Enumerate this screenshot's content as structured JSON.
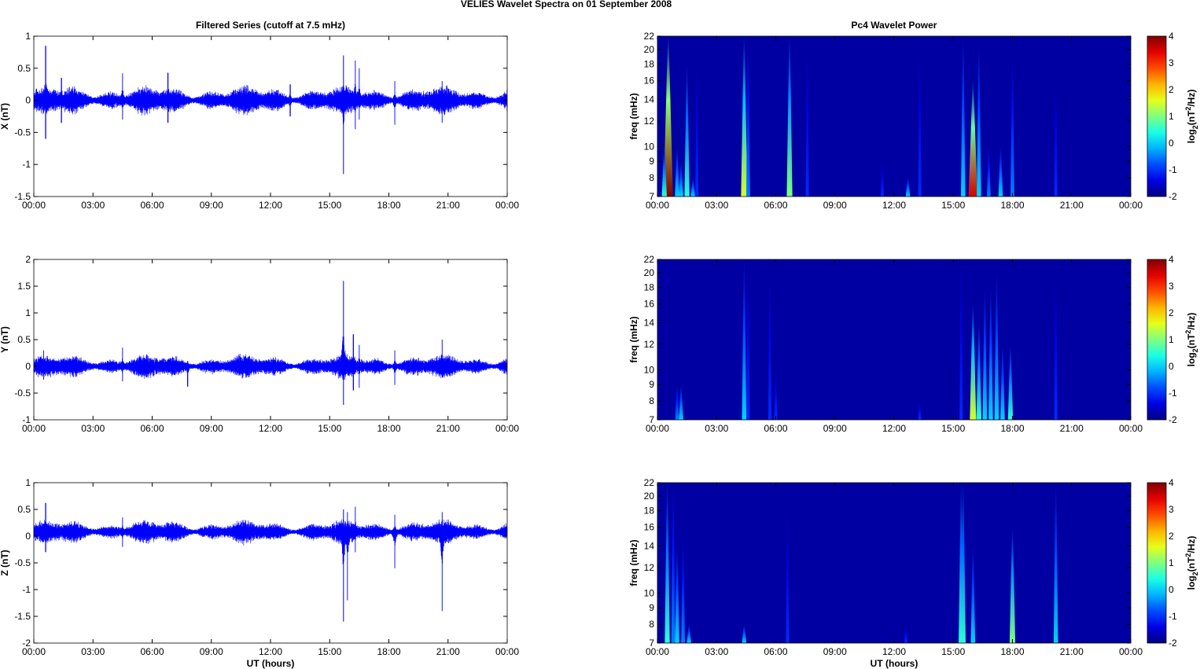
{
  "title": "VELIES Wavelet Spectra on 01 September 2008",
  "time_ticks": [
    "00:00",
    "03:00",
    "06:00",
    "09:00",
    "12:00",
    "15:00",
    "18:00",
    "21:00",
    "00:00"
  ],
  "xlabel": "UT (hours)",
  "colors": {
    "series": "#0000ff",
    "background": "#ffffff"
  },
  "chart_data": [
    {
      "type": "line",
      "panel": "left-1",
      "title": "Filtered Series (cutoff at 7.5 mHz)",
      "ylabel": "X (nT)",
      "xlim": [
        0,
        24
      ],
      "ylim": [
        -1.5,
        1
      ],
      "yticks": [
        "-1.5",
        "-1",
        "-0.5",
        "0",
        "0.5",
        "1"
      ],
      "ytick_values": [
        -1.5,
        -1,
        -0.5,
        0,
        0.5,
        1
      ],
      "baseline": 0.0,
      "noise_amplitude": 0.1,
      "spikes": [
        [
          0.6,
          0.85,
          -0.6
        ],
        [
          1.4,
          0.35,
          -0.35
        ],
        [
          4.5,
          0.42,
          -0.3
        ],
        [
          6.8,
          0.43,
          -0.35
        ],
        [
          13.0,
          0.25,
          -0.25
        ],
        [
          15.7,
          0.7,
          -1.15
        ],
        [
          16.3,
          0.62,
          -0.45
        ],
        [
          16.5,
          0.5,
          -0.3
        ],
        [
          18.3,
          0.3,
          -0.38
        ],
        [
          20.7,
          0.3,
          -0.35
        ]
      ]
    },
    {
      "type": "heatmap",
      "panel": "right-1",
      "title": "Pc4 Wavelet Power",
      "ylabel": "freq (mHz)",
      "xlim": [
        0,
        24
      ],
      "ylim": [
        7,
        22
      ],
      "yscale": "log",
      "yticks": [
        "7",
        "8",
        "9",
        "10",
        "12",
        "14",
        "16",
        "18",
        "20",
        "22"
      ],
      "ytick_values": [
        7,
        8,
        9,
        10,
        12,
        14,
        16,
        18,
        20,
        22
      ],
      "clim": [
        -2,
        4
      ],
      "cticks": [
        "-2",
        "-1",
        "0",
        "1",
        "2",
        "3",
        "4"
      ],
      "background_power": -1.8,
      "bursts_hour_fmax_peakpower": [
        [
          0.55,
          22,
          4
        ],
        [
          0.35,
          10,
          0.5
        ],
        [
          1.0,
          10,
          0
        ],
        [
          1.2,
          9,
          0
        ],
        [
          1.5,
          18,
          0.5
        ],
        [
          1.8,
          8,
          0
        ],
        [
          2.0,
          18,
          -1
        ],
        [
          4.4,
          22,
          1.5
        ],
        [
          4.6,
          22,
          -0.5
        ],
        [
          6.7,
          22,
          1
        ],
        [
          7.6,
          20,
          -1
        ],
        [
          11.4,
          9,
          -1
        ],
        [
          12.7,
          8,
          0
        ],
        [
          13.3,
          20,
          -1
        ],
        [
          15.5,
          22,
          0
        ],
        [
          16.0,
          16,
          3.5
        ],
        [
          16.3,
          21,
          0
        ],
        [
          16.8,
          10,
          -0.5
        ],
        [
          17.4,
          10,
          0
        ],
        [
          18.0,
          19,
          -0.5
        ],
        [
          20.2,
          16,
          -1
        ]
      ]
    },
    {
      "type": "line",
      "panel": "left-2",
      "ylabel": "Y (nT)",
      "xlim": [
        0,
        24
      ],
      "ylim": [
        -1,
        2
      ],
      "yticks": [
        "-1",
        "-0.5",
        "0",
        "0.5",
        "1",
        "1.5",
        "2"
      ],
      "ytick_values": [
        -1,
        -0.5,
        0,
        0.5,
        1,
        1.5,
        2
      ],
      "baseline": 0.0,
      "noise_amplitude": 0.1,
      "spikes": [
        [
          0.5,
          0.3,
          -0.25
        ],
        [
          4.5,
          0.35,
          -0.28
        ],
        [
          7.8,
          0.1,
          -0.38
        ],
        [
          15.7,
          1.6,
          -0.72
        ],
        [
          16.2,
          0.6,
          -0.45
        ],
        [
          16.5,
          0.4,
          -0.4
        ],
        [
          18.3,
          0.3,
          -0.35
        ],
        [
          20.7,
          0.5,
          -0.2
        ]
      ]
    },
    {
      "type": "heatmap",
      "panel": "right-2",
      "ylabel": "freq (mHz)",
      "xlim": [
        0,
        24
      ],
      "ylim": [
        7,
        22
      ],
      "yscale": "log",
      "yticks": [
        "7",
        "8",
        "9",
        "10",
        "12",
        "14",
        "16",
        "18",
        "20",
        "22"
      ],
      "ytick_values": [
        7,
        8,
        9,
        10,
        12,
        14,
        16,
        18,
        20,
        22
      ],
      "clim": [
        -2,
        4
      ],
      "cticks": [
        "-2",
        "-1",
        "0",
        "1",
        "2",
        "3",
        "4"
      ],
      "background_power": -1.8,
      "bursts_hour_fmax_peakpower": [
        [
          1.0,
          9,
          -0.5
        ],
        [
          1.2,
          9,
          0
        ],
        [
          4.4,
          22,
          0
        ],
        [
          4.6,
          22,
          -1
        ],
        [
          5.7,
          20,
          -1
        ],
        [
          6.0,
          10,
          -1
        ],
        [
          13.3,
          8,
          -1
        ],
        [
          15.4,
          22,
          -1
        ],
        [
          16.0,
          16,
          1.5
        ],
        [
          16.3,
          14,
          0.5
        ],
        [
          16.6,
          18,
          0
        ],
        [
          16.9,
          18,
          0
        ],
        [
          17.2,
          20,
          0
        ],
        [
          17.5,
          12,
          0
        ],
        [
          17.9,
          12,
          0.5
        ],
        [
          20.2,
          20,
          -1
        ]
      ]
    },
    {
      "type": "line",
      "panel": "left-3",
      "ylabel": "Z (nT)",
      "xlim": [
        0,
        24
      ],
      "ylim": [
        -2,
        1
      ],
      "yticks": [
        "-2",
        "-1.5",
        "-1",
        "-0.5",
        "0",
        "0.5",
        "1"
      ],
      "ytick_values": [
        -2,
        -1.5,
        -1,
        -0.5,
        0,
        0.5,
        1
      ],
      "baseline": 0.08,
      "noise_amplitude": 0.1,
      "spikes": [
        [
          0.6,
          0.62,
          -0.3
        ],
        [
          4.5,
          0.35,
          -0.2
        ],
        [
          15.7,
          0.5,
          -1.6
        ],
        [
          15.9,
          0.45,
          -1.2
        ],
        [
          16.3,
          0.55,
          -0.3
        ],
        [
          18.3,
          0.4,
          -0.6
        ],
        [
          20.7,
          0.45,
          -1.4
        ]
      ]
    },
    {
      "type": "heatmap",
      "panel": "right-3",
      "ylabel": "freq (mHz)",
      "xlim": [
        0,
        24
      ],
      "ylim": [
        7,
        22
      ],
      "yscale": "log",
      "yticks": [
        "7",
        "8",
        "9",
        "10",
        "12",
        "14",
        "16",
        "18",
        "20",
        "22"
      ],
      "ytick_values": [
        7,
        8,
        9,
        10,
        12,
        14,
        16,
        18,
        20,
        22
      ],
      "clim": [
        -2,
        4
      ],
      "cticks": [
        "-2",
        "-1",
        "0",
        "1",
        "2",
        "3",
        "4"
      ],
      "background_power": -1.8,
      "bursts_hour_fmax_peakpower": [
        [
          0.5,
          22,
          0.5
        ],
        [
          0.8,
          22,
          -0.5
        ],
        [
          1.0,
          14,
          0
        ],
        [
          1.3,
          15,
          -0.5
        ],
        [
          1.6,
          8,
          0
        ],
        [
          4.4,
          8,
          0
        ],
        [
          6.6,
          18,
          -1
        ],
        [
          12.6,
          8,
          -1
        ],
        [
          15.4,
          22,
          0.5
        ],
        [
          15.5,
          22,
          0.5
        ],
        [
          16.0,
          14,
          0
        ],
        [
          18.0,
          16,
          1
        ],
        [
          20.2,
          22,
          0
        ]
      ]
    }
  ],
  "colorbar_label": {
    "base": "log",
    "sub": "2",
    "unit_open": "(nT",
    "sup": "2",
    "unit_close": "/Hz)"
  }
}
